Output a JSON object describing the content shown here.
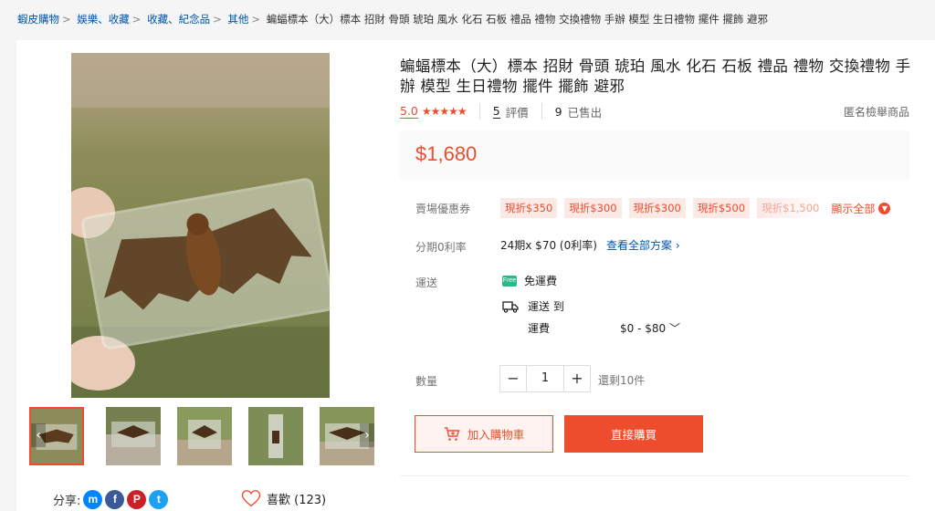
{
  "breadcrumb": {
    "items": [
      "蝦皮購物",
      "娛樂、收藏",
      "收藏、紀念品",
      "其他"
    ],
    "current": "蝙蝠標本（大）標本 招財 骨頭 琥珀 風水 化石 石板 禮品 禮物 交換禮物 手辦 模型 生日禮物 擺件 擺飾 避邪",
    "separator": ">"
  },
  "product": {
    "title": "蝙蝠標本（大）標本 招財 骨頭 琥珀 風水 化石 石板 禮品 禮物 交換禮物 手辦 模型 生日禮物 擺件 擺飾 避邪",
    "rating": "5.0",
    "stars": "★★★★★",
    "review_count": "5",
    "review_label": "評價",
    "sold_count": "9",
    "sold_label": "已售出",
    "report_label": "匿名檢舉商品",
    "price": "$1,680"
  },
  "coupons": {
    "label": "賣場優惠券",
    "items": [
      "現折$350",
      "現折$300",
      "現折$300",
      "現折$500",
      "現折$1,500"
    ],
    "show_all": "顯示全部"
  },
  "installment": {
    "label": "分期0利率",
    "value": "24期x $70 (0利率)",
    "link": "查看全部方案"
  },
  "shipping": {
    "label": "運送",
    "free": "免運費",
    "free_badge": "Free",
    "ship_to": "運送 到",
    "fee_label": "運費",
    "fee_value": "$0 - $80"
  },
  "quantity": {
    "label": "數量",
    "value": "1",
    "minus": "−",
    "plus": "+",
    "stock": "還剩10件"
  },
  "actions": {
    "add_to_cart": "加入購物車",
    "buy_now": "直接購買"
  },
  "social": {
    "share_label": "分享:",
    "like_label": "喜歡 (123)"
  },
  "colors": {
    "accent": "#ee4d2d",
    "link": "#0055aa"
  }
}
